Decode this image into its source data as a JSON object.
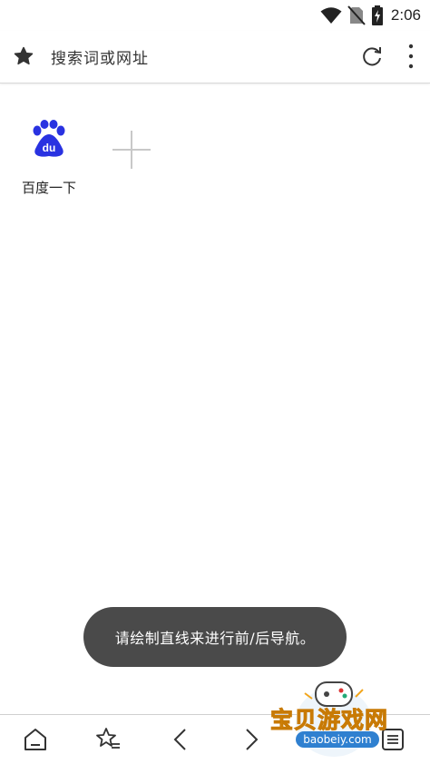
{
  "status_bar": {
    "time": "2:06",
    "icons": [
      "wifi-icon",
      "no-sim-icon",
      "battery-charging-icon"
    ]
  },
  "address_bar": {
    "placeholder": "搜索词或网址",
    "icons": [
      "bookmark-star-icon",
      "refresh-icon",
      "more-vertical-icon"
    ]
  },
  "speed_dial": {
    "tiles": [
      {
        "label": "百度一下",
        "icon": "baidu-paw-logo"
      }
    ],
    "add_icon": "plus-icon"
  },
  "toast": {
    "message": "请绘制直线来进行前/后导航。"
  },
  "bottom_toolbar": {
    "icons": [
      "home-icon",
      "bookmarks-list-icon",
      "back-arrow-icon",
      "forward-arrow-icon",
      "tabs-icon",
      "menu-list-icon"
    ]
  },
  "watermark": {
    "title": "宝贝游戏网",
    "url": "baobeiy.com"
  },
  "colors": {
    "baidu_blue": "#2932e1",
    "toast_bg": "#4a4a4a",
    "watermark_orange": "#f2a51b",
    "watermark_blue": "#2f80d0"
  }
}
